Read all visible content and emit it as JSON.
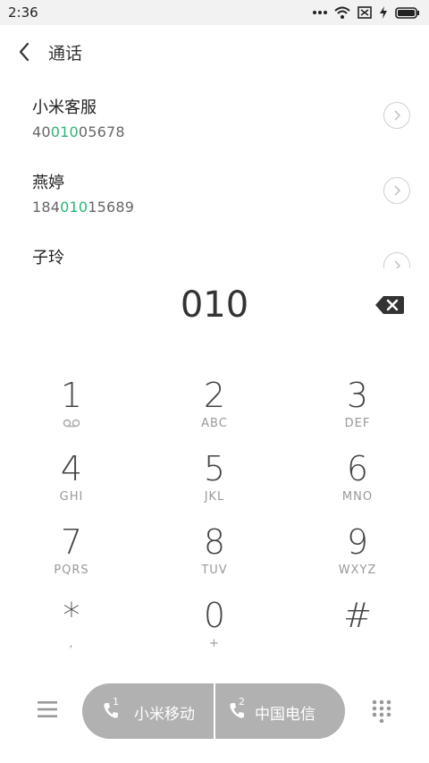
{
  "status_bar": {
    "time": "2:36"
  },
  "header": {
    "title": "通话"
  },
  "contacts": [
    {
      "name": "小米客服",
      "number_prefix": "40",
      "number_match": "010",
      "number_suffix": "05678"
    },
    {
      "name": "燕婷",
      "number_prefix": "184",
      "number_match": "010",
      "number_suffix": "15689"
    },
    {
      "name": "子玲",
      "number_prefix": "",
      "number_match": "",
      "number_suffix": ""
    }
  ],
  "dialed_number": "010",
  "keypad": [
    {
      "digit": "1",
      "letters": ""
    },
    {
      "digit": "2",
      "letters": "ABC"
    },
    {
      "digit": "3",
      "letters": "DEF"
    },
    {
      "digit": "4",
      "letters": "GHI"
    },
    {
      "digit": "5",
      "letters": "JKL"
    },
    {
      "digit": "6",
      "letters": "MNO"
    },
    {
      "digit": "7",
      "letters": "PQRS"
    },
    {
      "digit": "8",
      "letters": "TUV"
    },
    {
      "digit": "9",
      "letters": "WXYZ"
    },
    {
      "digit": "*",
      "letters": ","
    },
    {
      "digit": "0",
      "letters": "+"
    },
    {
      "digit": "#",
      "letters": ""
    }
  ],
  "call_buttons": {
    "sim1": {
      "slot": "1",
      "label": "小米移动"
    },
    "sim2": {
      "slot": "2",
      "label": "中国电信"
    }
  },
  "colors": {
    "match_highlight": "#2bb673",
    "call_pill": "#b1b1b1"
  }
}
